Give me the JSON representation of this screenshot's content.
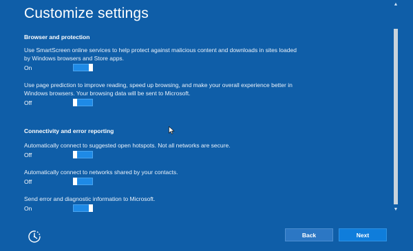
{
  "page_title": "Customize settings",
  "sections": {
    "browser": {
      "heading": "Browser and protection",
      "smartscreen": {
        "description": "Use SmartScreen online services to help protect against malicious content and downloads in sites loaded by Windows browsers and Store apps.",
        "state": "On"
      },
      "page_prediction": {
        "description": "Use page prediction to improve reading, speed up browsing, and make your overall experience better in Windows browsers. Your browsing data will be sent to Microsoft.",
        "state": "Off"
      }
    },
    "connectivity": {
      "heading": "Connectivity and error reporting",
      "hotspots": {
        "description": "Automatically connect to suggested open hotspots. Not all networks are secure.",
        "state": "Off"
      },
      "shared_networks": {
        "description": "Automatically connect to networks shared by your contacts.",
        "state": "Off"
      },
      "error_reporting": {
        "description": "Send error and diagnostic information to Microsoft.",
        "state": "On"
      }
    }
  },
  "buttons": {
    "back": "Back",
    "next": "Next"
  },
  "icons": {
    "ease_of_access": "ease-of-access-icon",
    "pointer": "cursor-icon",
    "scroll_up": "scroll-up-arrow",
    "scroll_down": "scroll-down-arrow"
  },
  "colors": {
    "background": "#0f5ea8",
    "toggle_track": "#1e8ae6",
    "next_button": "#0f7ddb",
    "back_button": "#2c77c4"
  }
}
